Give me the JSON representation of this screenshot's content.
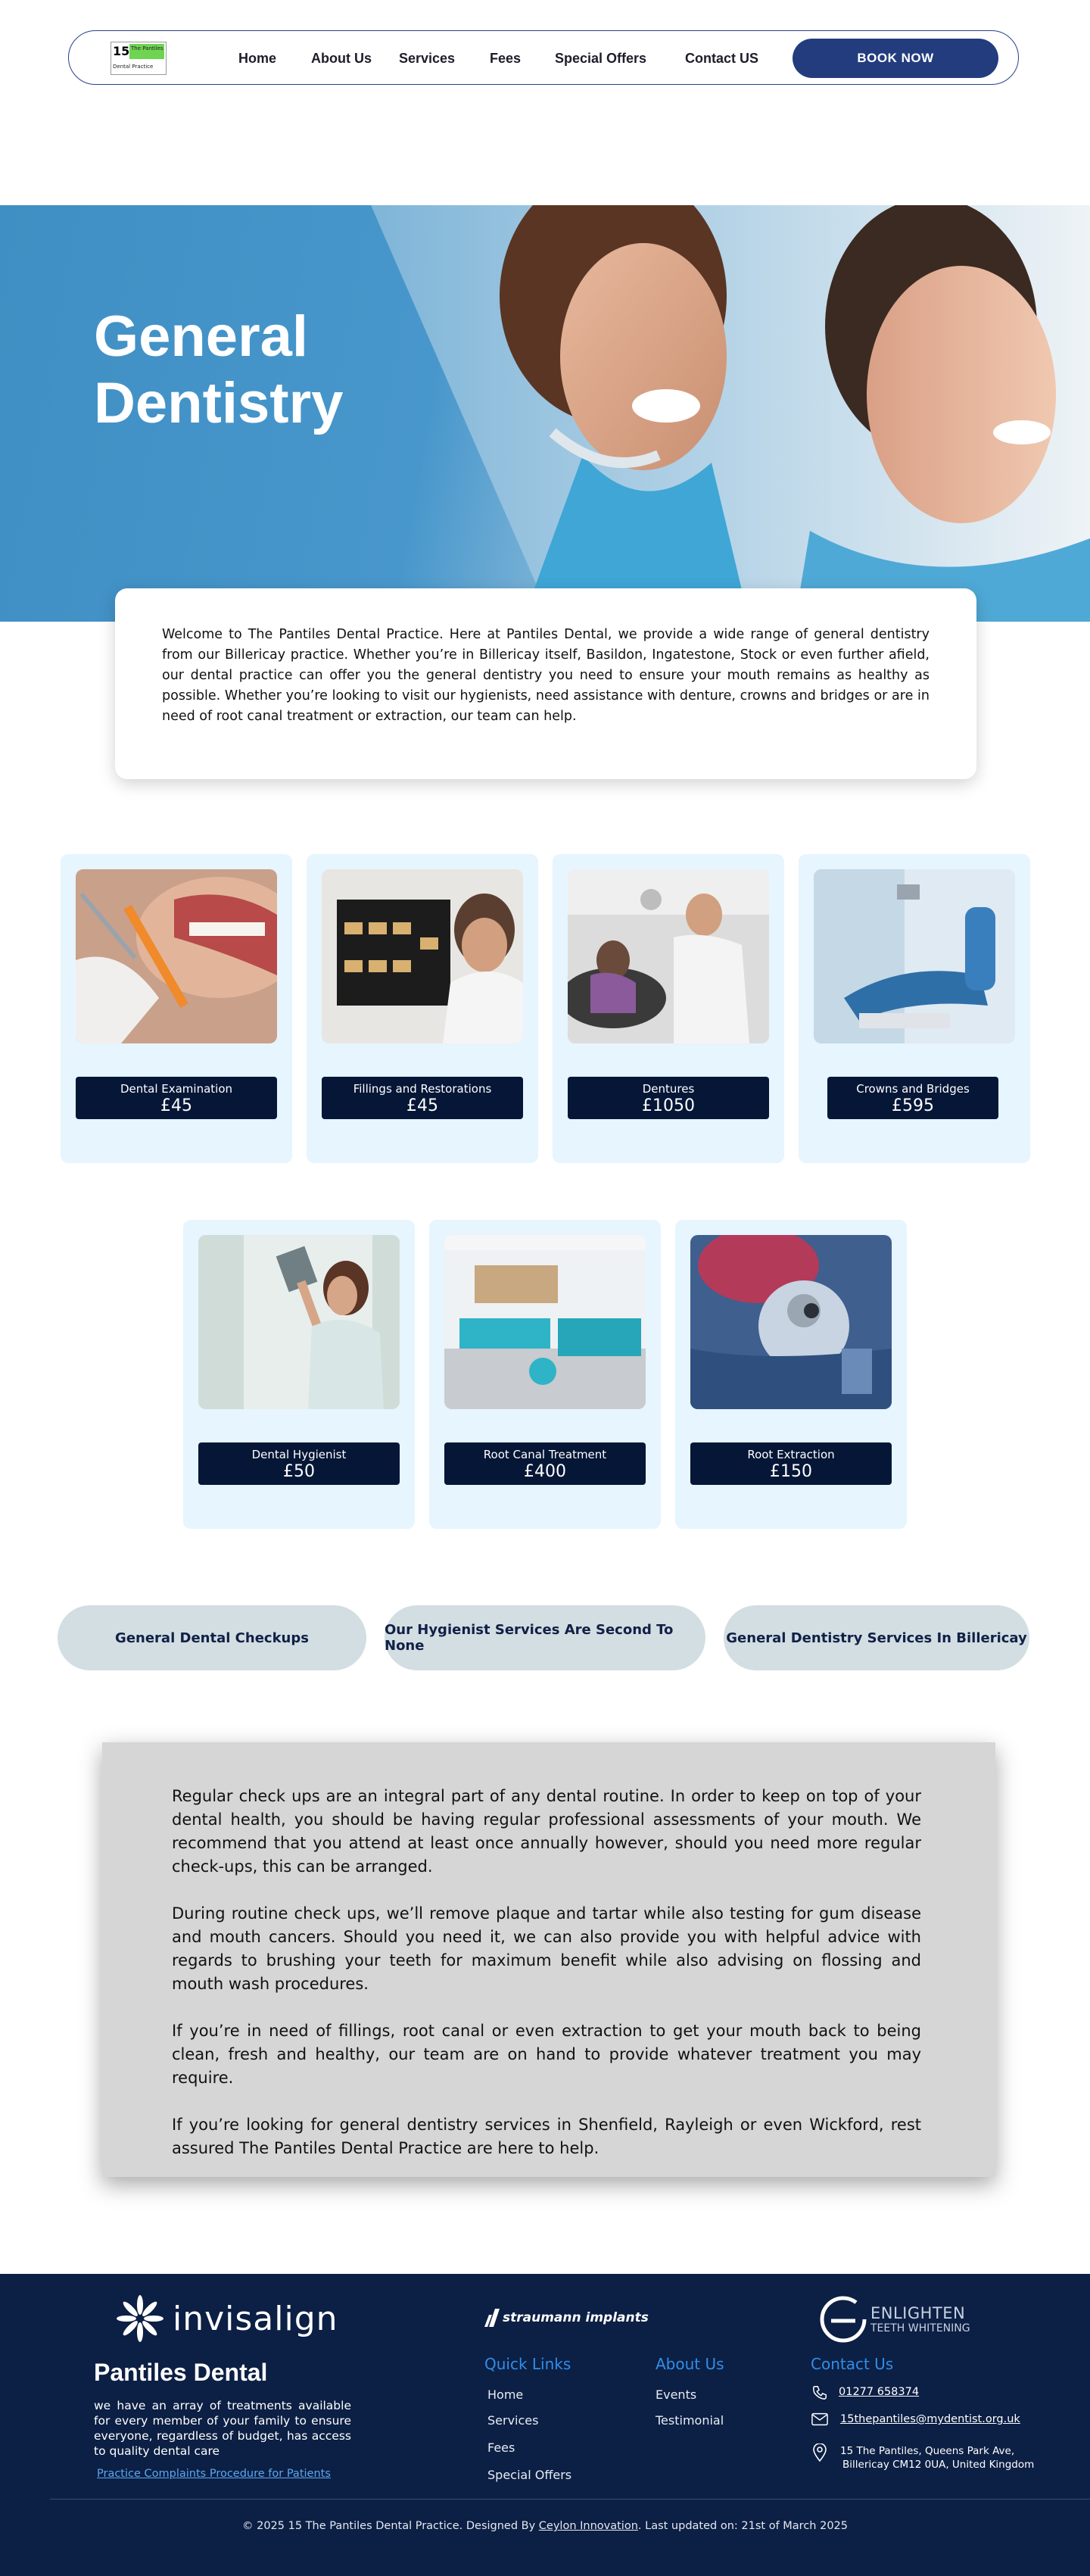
{
  "nav": {
    "logo": {
      "number": "15",
      "top_text": "The Pantiles",
      "bottom_text": "Dental Practice"
    },
    "links": [
      "Home",
      "About Us",
      "Services",
      "Fees",
      "Special Offers",
      "Contact US"
    ],
    "book": "BOOK NOW"
  },
  "hero": {
    "title_line1": "General",
    "title_line2": "Dentistry",
    "welcome": "Welcome to The Pantiles Dental Practice. Here at Pantiles Dental, we provide a wide range of general dentistry from our Billericay practice. Whether you’re in Billericay itself, Basildon, Ingatestone, Stock or even further afield, our dental practice can offer you the general dentistry you need to ensure your mouth remains as healthy as possible. Whether you’re looking to visit our hygienists, need assistance with denture, crowns and bridges or are in need of root canal treatment or extraction, our team can help."
  },
  "services": [
    {
      "name": "Dental Examination",
      "price": "£45"
    },
    {
      "name": "Fillings and Restorations",
      "price": "£45"
    },
    {
      "name": "Dentures",
      "price": "£1050"
    },
    {
      "name": "Crowns and Bridges",
      "price": "£595"
    },
    {
      "name": "Dental Hygienist",
      "price": "£50"
    },
    {
      "name": "Root Canal Treatment",
      "price": "£400"
    },
    {
      "name": "Root Extraction",
      "price": "£150"
    }
  ],
  "pills": [
    "General Dental Checkups",
    "Our Hygienist Services Are Second To None",
    "General Dentistry Services In Billericay"
  ],
  "info": [
    "Regular check ups are an integral part of any dental routine. In order to keep on top of your dental health, you should be having regular professional assessments of your mouth. We recommend that you attend at least once annually however, should you need more regular check-ups, this can be arranged.",
    "During routine check ups, we’ll remove plaque and tartar while also testing for gum disease and mouth cancers. Should you need it, we can also provide you with helpful advice with regards to brushing your teeth for maximum benefit while also advising on flossing and mouth wash procedures.",
    "If you’re in need of fillings, root canal or even extraction to get your mouth back to being clean, fresh and healthy, our team are on hand to provide whatever treatment you may require.",
    "If you’re looking for general dentistry services in Shenfield, Rayleigh or even Wickford, rest assured The Pantiles Dental Practice are here to help."
  ],
  "footer": {
    "brands": {
      "invisalign": "invisalign",
      "straumann": "straumann implants",
      "enlighten_top": "ENLIGHTEN",
      "enlighten_bottom": "TEETH WHITENING"
    },
    "title": "Pantiles Dental",
    "description": "we have an array of treatments available for every member of your family to ensure everyone, regardless of budget, has access to quality dental care",
    "complaints": "Practice Complaints Procedure for Patients",
    "quick_links_heading": "Quick Links",
    "quick_links": [
      "Home",
      "Services",
      "Fees",
      "Special Offers"
    ],
    "about_heading": "About Us",
    "about_links": [
      "Events",
      "Testimonial"
    ],
    "contact_heading": "Contact Us",
    "phone": "01277 658374",
    "email": "15thepantiles@mydentist.org.uk",
    "address_line1": "15 The Pantiles, Queens Park Ave,",
    "address_line2": "Billericay CM12 0UA, United Kingdom",
    "copyright_pre": "© 2025 15 The Pantiles Dental Practice. Designed By ",
    "designer": "Ceylon Innovation",
    "copyright_post": ". Last updated on: 21st of March 2025"
  },
  "colors": {
    "navy": "#0c1f44",
    "book_button": "#233c7e",
    "card_bg": "#e6f5fe",
    "pill_bg": "#d3dee3",
    "link_blue": "#2f8fea"
  }
}
